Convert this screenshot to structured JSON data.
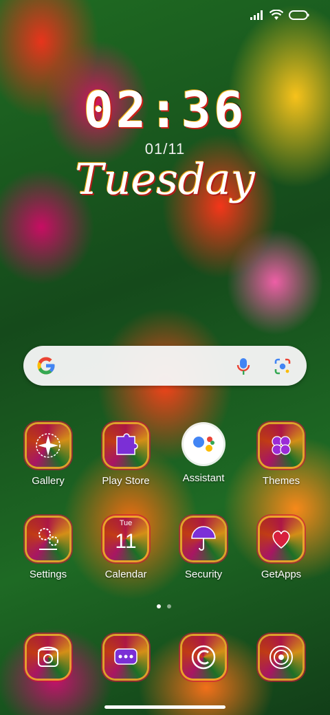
{
  "status": {
    "signal_icon": "signal-icon",
    "wifi_icon": "wifi-icon",
    "battery_icon": "battery-icon"
  },
  "clock": {
    "time": "02:36",
    "date": "01/11",
    "weekday": "Tuesday"
  },
  "search": {
    "logo": "google-g-icon",
    "mic": "mic-icon",
    "lens": "lens-icon"
  },
  "apps": [
    {
      "label": "Gallery",
      "icon": "gallery-icon"
    },
    {
      "label": "Play Store",
      "icon": "play-store-icon"
    },
    {
      "label": "Assistant",
      "icon": "assistant-icon"
    },
    {
      "label": "Themes",
      "icon": "themes-icon"
    },
    {
      "label": "Settings",
      "icon": "settings-icon"
    },
    {
      "label": "Calendar",
      "icon": "calendar-icon",
      "day": "Tue",
      "date": "11"
    },
    {
      "label": "Security",
      "icon": "security-icon"
    },
    {
      "label": "GetApps",
      "icon": "getapps-icon"
    }
  ],
  "dock": [
    {
      "icon": "phone-icon"
    },
    {
      "icon": "messages-icon"
    },
    {
      "icon": "browser-icon"
    },
    {
      "icon": "camera-icon"
    }
  ],
  "page_indicator": {
    "pages": 2,
    "active": 1
  },
  "colors": {
    "google_blue": "#4285F4",
    "google_red": "#EA4335",
    "google_yellow": "#FBBC05",
    "google_green": "#34A853"
  }
}
